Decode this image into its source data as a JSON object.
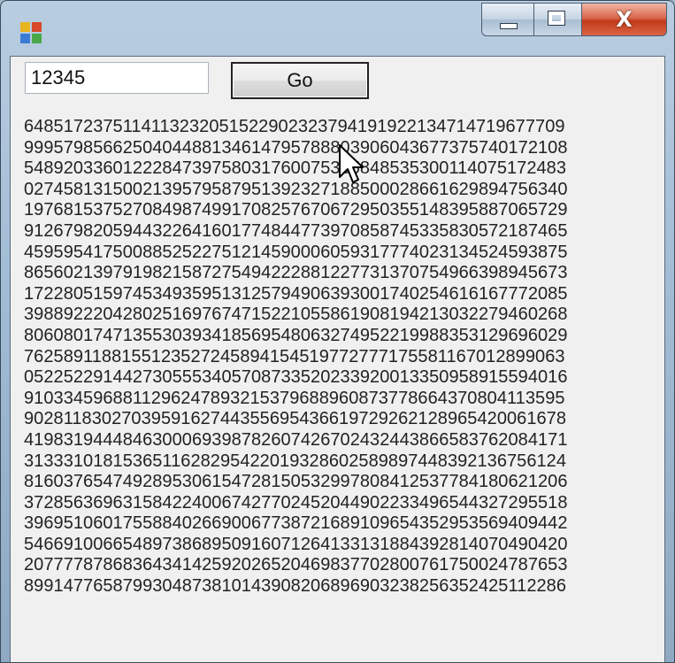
{
  "window": {
    "title": "",
    "icon": "app-icon",
    "controls": {
      "minimize": "minimize-icon",
      "maximize": "maximize-icon",
      "close_glyph": "X"
    }
  },
  "form": {
    "input_value": "12345",
    "go_label": "Go"
  },
  "output_lines": [
    "6485172375114113232051522902323794191922134714719677709",
    "9995798566250404488134614795788803906043677375740172108",
    "5489203360122284739758031760075335848535300114075172483",
    "0274581315002139579587951392327188500028661629894756340",
    "1976815375270849874991708257670672950355148395887065729",
    "9126798205944322641601774844773970858745335830572187465",
    "4595954175008852522751214590006059317774023134524593875",
    "8656021397919821587275494222881227731370754966398945673",
    "1722805159745349359513125794906393001740254616167772085",
    "3988922204280251697674715221055861908194213032279460268",
    "8060801747135530393418569548063274952219988353129696029",
    "7625891188155123527245894154519772777175581167012899063",
    "0522522914427305553405708733520233920013350958915594016",
    "9103345968811296247893215379688960873778664370804113595",
    "9028118302703959162744355695436619729262128965420061678",
    "4198319444846300069398782607426702432443866583762084171",
    "3133310181536511628295422019328602589897448392136756124",
    "8160376547492895306154728150532997808412537784180621206",
    "3728563696315842240067427702452044902233496544327295518",
    "3969510601755884026690067738721689109654352953569409442",
    "5466910066548973868950916071264133131884392814070490420",
    "2077778786836434142592026520469837702800761750024787653",
    "8991477658799304873810143908206896903238256352425112286"
  ]
}
